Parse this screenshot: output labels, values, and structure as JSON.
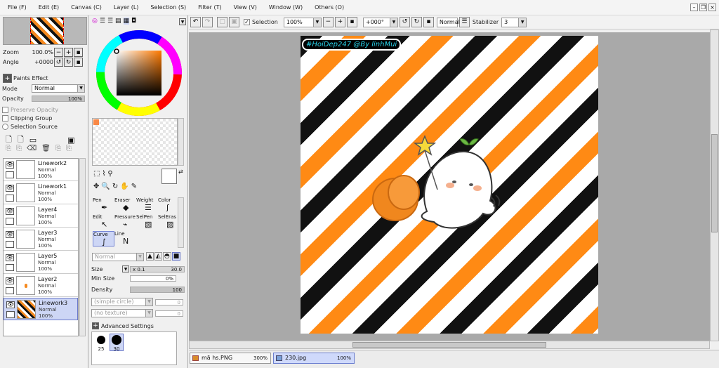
{
  "menu": [
    "File (F)",
    "Edit (E)",
    "Canvas (C)",
    "Layer (L)",
    "Selection (S)",
    "Filter (T)",
    "View (V)",
    "Window (W)",
    "Others (O)"
  ],
  "navigator": {
    "zoom_label": "Zoom",
    "zoom_value": "100.0%",
    "angle_label": "Angle",
    "angle_value": "+0000"
  },
  "paint_effect": {
    "title": "Paints Effect",
    "mode_label": "Mode",
    "mode_value": "Normal",
    "opacity_label": "Opacity",
    "opacity_value": "100%",
    "opacity_fraction": 1.0
  },
  "layer_options": {
    "preserve_opacity": "Preserve Opacity",
    "clipping_group": "Clipping Group",
    "selection_source": "Selection Source"
  },
  "layers": [
    {
      "name": "Linework2",
      "mode": "Normal",
      "opacity": "100%",
      "selected": false
    },
    {
      "name": "Linework1",
      "mode": "Normal",
      "opacity": "100%",
      "selected": false
    },
    {
      "name": "Layer4",
      "mode": "Normal",
      "opacity": "100%",
      "selected": false
    },
    {
      "name": "Layer3",
      "mode": "Normal",
      "opacity": "100%",
      "selected": false
    },
    {
      "name": "Layer5",
      "mode": "Normal",
      "opacity": "100%",
      "selected": false
    },
    {
      "name": "Layer2",
      "mode": "Normal",
      "opacity": "100%",
      "selected": false
    },
    {
      "name": "Linework3",
      "mode": "Normal",
      "opacity": "100%",
      "selected": true
    }
  ],
  "tools": {
    "row1": [
      "Pen",
      "Eraser",
      "Weight",
      "Color"
    ],
    "row2": [
      "Edit",
      "Pressure",
      "SelPen",
      "SelEras"
    ],
    "row3": [
      "Curve",
      "Line"
    ]
  },
  "brush": {
    "blend_value": "Normal",
    "size_label": "Size",
    "size_mult": "x 0.1",
    "size_value": "30.0",
    "min_size_label": "Min Size",
    "min_size_value": "0%",
    "density_label": "Density",
    "density_value": "100",
    "density_fraction": 1.0,
    "shape": "(simple circle)",
    "shape_value": "0",
    "texture": "(no texture)",
    "texture_value": "0",
    "advanced": "Advanced Settings",
    "presets": [
      "25",
      "30"
    ]
  },
  "toolbar": {
    "selection_label": "Selection",
    "zoom_value": "100%",
    "rotation_value": "+000°",
    "blend_value": "Normal",
    "stabilizer_label": "Stabilizer",
    "stabilizer_value": "3"
  },
  "canvas": {
    "watermark": "#HoiDep247 @By linhMui"
  },
  "documents": [
    {
      "name": "mã hs.PNG",
      "zoom": "300%",
      "active": false
    },
    {
      "name": "230.jpg",
      "zoom": "100%",
      "active": true
    }
  ],
  "colors": {
    "orange": "#ff8a14",
    "black": "#111111",
    "selection": "#cdd6f5",
    "accent": "#6a78c8"
  }
}
